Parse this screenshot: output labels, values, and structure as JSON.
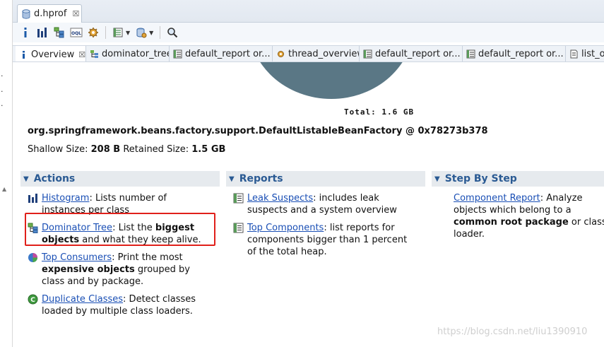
{
  "editor": {
    "tab_label": "d.hprof",
    "close_glyph": "☒"
  },
  "toolbar": {
    "buttons": [
      "info-icon",
      "histogram-icon",
      "dominator-tree-icon",
      "oql-icon",
      "gear-report-icon",
      "query-browser-icon",
      "heap-dump-icon",
      "search-icon"
    ],
    "oql_text": "OQL"
  },
  "subtabs": [
    {
      "label": "Overview",
      "icon": "info-icon",
      "closable": true
    },
    {
      "label": "dominator_tree",
      "icon": "dominator-tree-icon"
    },
    {
      "label": "default_report  or...",
      "icon": "report-icon"
    },
    {
      "label": "thread_overview",
      "icon": "gear-icon"
    },
    {
      "label": "default_report  or...",
      "icon": "report-icon"
    },
    {
      "label": "default_report  or...",
      "icon": "report-icon"
    },
    {
      "label": "list_ob",
      "icon": "list-icon"
    }
  ],
  "overview": {
    "total": "Total: 1.6 GB",
    "object": "org.springframework.beans.factory.support.DefaultListableBeanFactory @ 0x78273b378",
    "shallow_label": "Shallow Size: ",
    "shallow_value": "208 B",
    "retained_label": " Retained Size: ",
    "retained_value": "1.5 GB"
  },
  "sections": {
    "actions": {
      "title": "Actions",
      "histogram_link": "Histogram",
      "histogram_text": ": Lists number of instances per class",
      "dominator_link": "Dominator Tree",
      "dominator_text1": ": List the ",
      "dominator_bold": "biggest objects",
      "dominator_text2": " and what they keep alive.",
      "consumers_link": "Top Consumers",
      "consumers_text1": ": Print the most ",
      "consumers_bold": "expensive objects",
      "consumers_text2": " grouped by class and by package.",
      "duplicate_link": "Duplicate Classes",
      "duplicate_text": ": Detect classes loaded by multiple class loaders."
    },
    "reports": {
      "title": "Reports",
      "leak_link": "Leak Suspects",
      "leak_text": ": includes leak suspects and a system overview",
      "components_link": "Top Components",
      "components_text": ": list reports for components bigger than 1 percent of the total heap."
    },
    "stepbystep": {
      "title": "Step By Step",
      "component_link": "Component Report",
      "component_text1": ": Analyze objects which belong to a ",
      "component_bold": "common root package",
      "component_text2": " or class loader."
    }
  },
  "watermark": "https://blog.csdn.net/liu1390910",
  "colors": {
    "link": "#1a4fb5",
    "section_title": "#2a5a93",
    "pie": "#5a7785",
    "highlight": "#e0201a"
  }
}
